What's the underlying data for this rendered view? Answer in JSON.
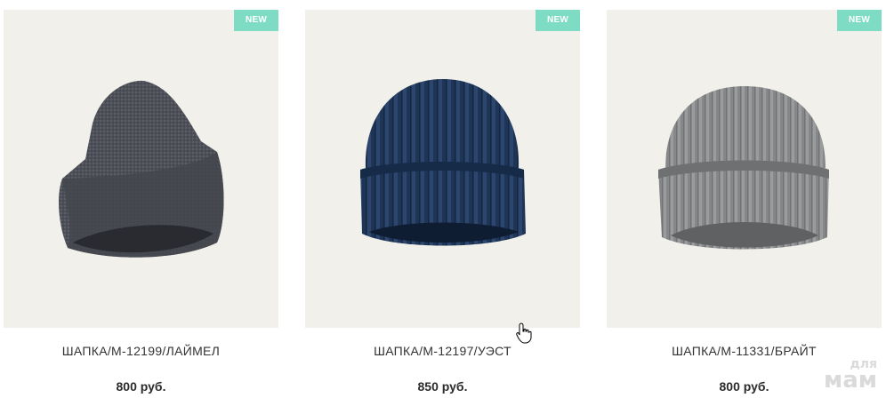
{
  "products": [
    {
      "badge": "NEW",
      "title": "ШАПКА/М-12199/ЛАЙМЕЛ",
      "price": "800 руб.",
      "image": "dark-gray-knit-beanie"
    },
    {
      "badge": "NEW",
      "title": "ШАПКА/М-12197/УЭСТ",
      "price": "850 руб.",
      "image": "navy-ribbed-beanie"
    },
    {
      "badge": "NEW",
      "title": "ШАПКА/М-11331/БРАЙТ",
      "price": "800 руб.",
      "image": "gray-ribbed-beanie"
    }
  ],
  "watermark": {
    "line1": "для",
    "line2": "мам"
  },
  "colors": {
    "badge": "#7fdcc4",
    "card_bg": "#f1f0ea",
    "text": "#333333"
  }
}
